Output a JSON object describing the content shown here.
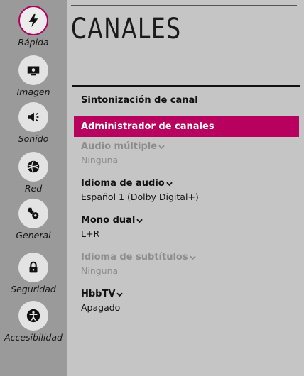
{
  "sidebar": {
    "items": [
      {
        "label": "Rápida",
        "icon": "lightning-icon"
      },
      {
        "label": "Imagen",
        "icon": "picture-icon"
      },
      {
        "label": "Sonido",
        "icon": "speaker-icon"
      },
      {
        "label": "Red",
        "icon": "network-globe-icon"
      },
      {
        "label": "General",
        "icon": "wrench-gear-icon"
      },
      {
        "label": "Seguridad",
        "icon": "lock-icon"
      },
      {
        "label": "Accesibilidad",
        "icon": "accessibility-icon"
      }
    ]
  },
  "main": {
    "title": "CANALES",
    "menu": [
      {
        "label": "Sintonización de canal"
      },
      {
        "label": "Administrador de canales"
      },
      {
        "label": "Audio múltiple",
        "value": "Ninguna"
      },
      {
        "label": "Idioma de audio",
        "value": "Español 1 (Dolby Digital+)"
      },
      {
        "label": "Mono dual",
        "value": "L+R"
      },
      {
        "label": "Idioma de subtítulos",
        "value": "Ninguna"
      },
      {
        "label": "HbbTV",
        "value": "Apagado"
      }
    ]
  },
  "colors": {
    "accent": "#b8005e",
    "sidebar_bg": "#9a9a9a",
    "main_bg": "#c5c5c5",
    "disabled_text": "#8d8d8d"
  }
}
